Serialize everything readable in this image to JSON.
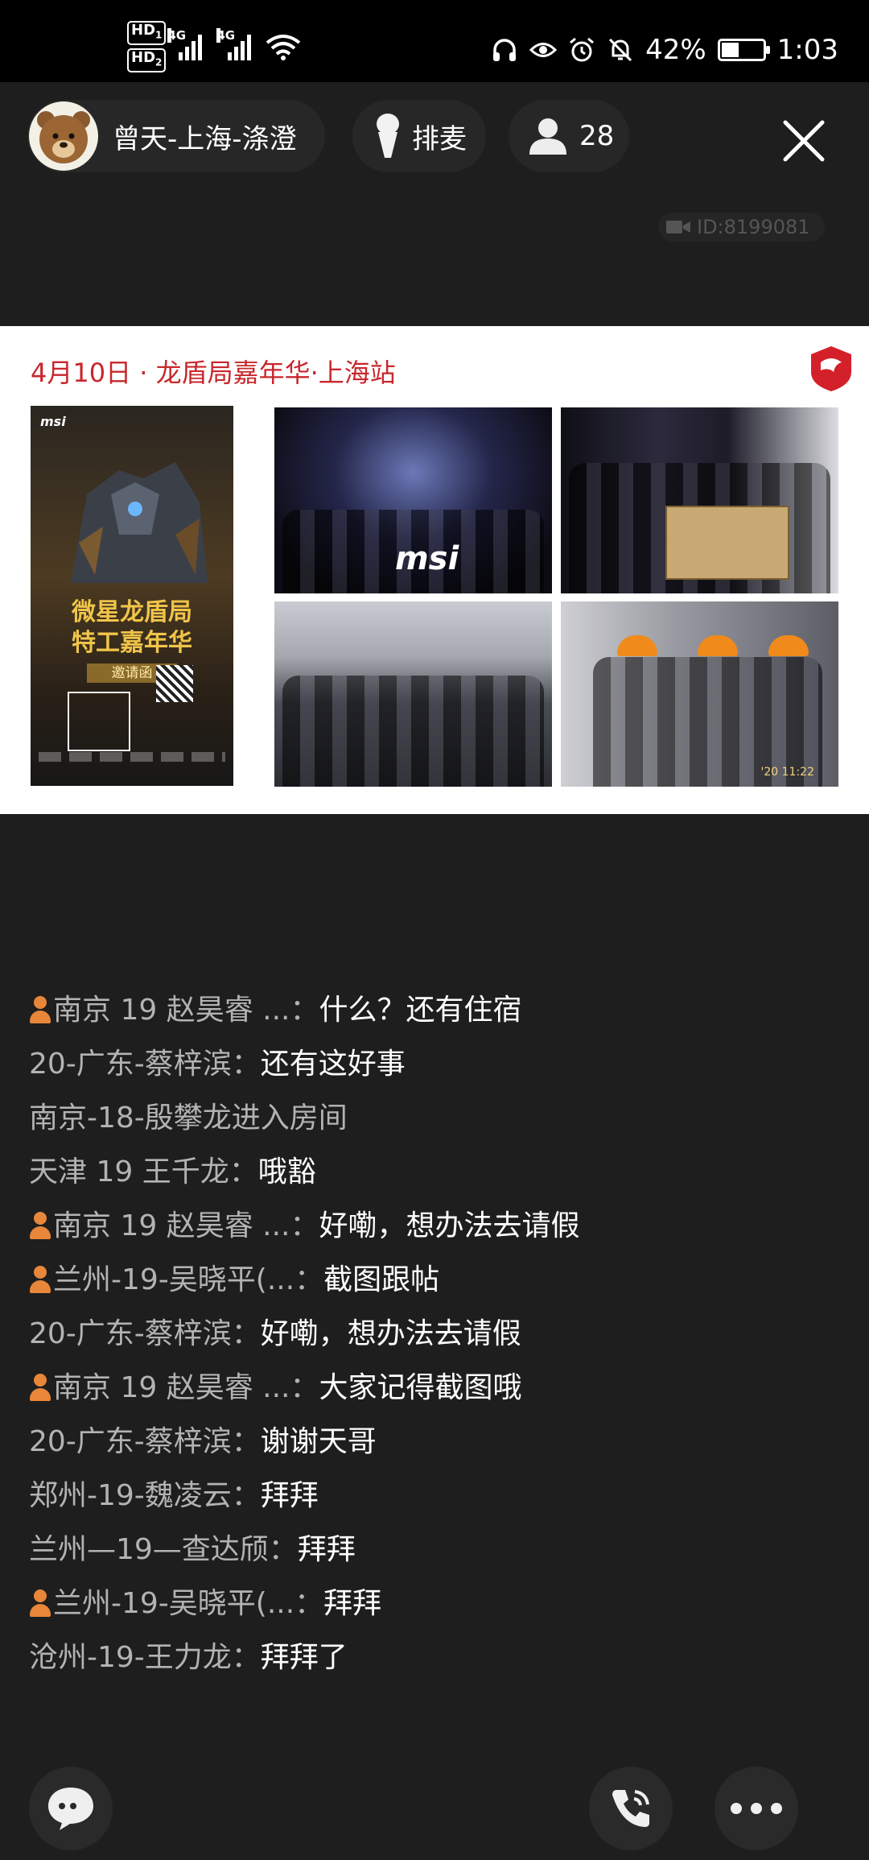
{
  "status_bar": {
    "hd1": "HD",
    "hd1_sub": "1",
    "hd2": "HD",
    "hd2_sub": "2",
    "net1": "4G",
    "net2": "4G",
    "battery_percent": "42%",
    "battery_level": 0.42,
    "time": "1:03",
    "icons": [
      "headphones-icon",
      "eye-icon",
      "alarm-icon",
      "mute-icon"
    ]
  },
  "header": {
    "host_name": "曾天-上海-涤澄",
    "queue_label": "排麦",
    "viewer_count": "28",
    "room_id": "ID:8199081"
  },
  "banner": {
    "title": "4月10日 · 龙盾局嘉年华·上海站",
    "poster_brand": "msi",
    "poster_title_line1": "微星龙盾局",
    "poster_title_line2": "特工嘉年华",
    "poster_tag": "邀请函",
    "photo1_logo": "msi",
    "photo4_stamp": "'20 11:22"
  },
  "chat": [
    {
      "badge": true,
      "sender": "南京 19 赵昊睿 ...：",
      "text": "什么？还有住宿"
    },
    {
      "badge": false,
      "sender": "20-广东-蔡梓滨：",
      "text": "还有这好事"
    },
    {
      "badge": false,
      "sender": "南京-18-殷攀龙进入房间",
      "text": "",
      "type": "join"
    },
    {
      "badge": false,
      "sender": "天津  19 王千龙：",
      "text": "哦豁"
    },
    {
      "badge": true,
      "sender": "南京 19 赵昊睿 ...：",
      "text": "好嘞，想办法去请假"
    },
    {
      "badge": true,
      "sender": "兰州-19-吴晓平(...：",
      "text": "截图跟帖"
    },
    {
      "badge": false,
      "sender": "20-广东-蔡梓滨：",
      "text": "好嘞，想办法去请假"
    },
    {
      "badge": true,
      "sender": "南京 19 赵昊睿 ...：",
      "text": "大家记得截图哦"
    },
    {
      "badge": false,
      "sender": "20-广东-蔡梓滨：",
      "text": "谢谢天哥"
    },
    {
      "badge": false,
      "sender": "郑州-19-魏凌云：",
      "text": "拜拜"
    },
    {
      "badge": false,
      "sender": "兰州—19—查达颀：",
      "text": "拜拜"
    },
    {
      "badge": true,
      "sender": "兰州-19-吴晓平(...：",
      "text": "拜拜"
    },
    {
      "badge": false,
      "sender": "沧州-19-王力龙：",
      "text": "拜拜了"
    }
  ]
}
